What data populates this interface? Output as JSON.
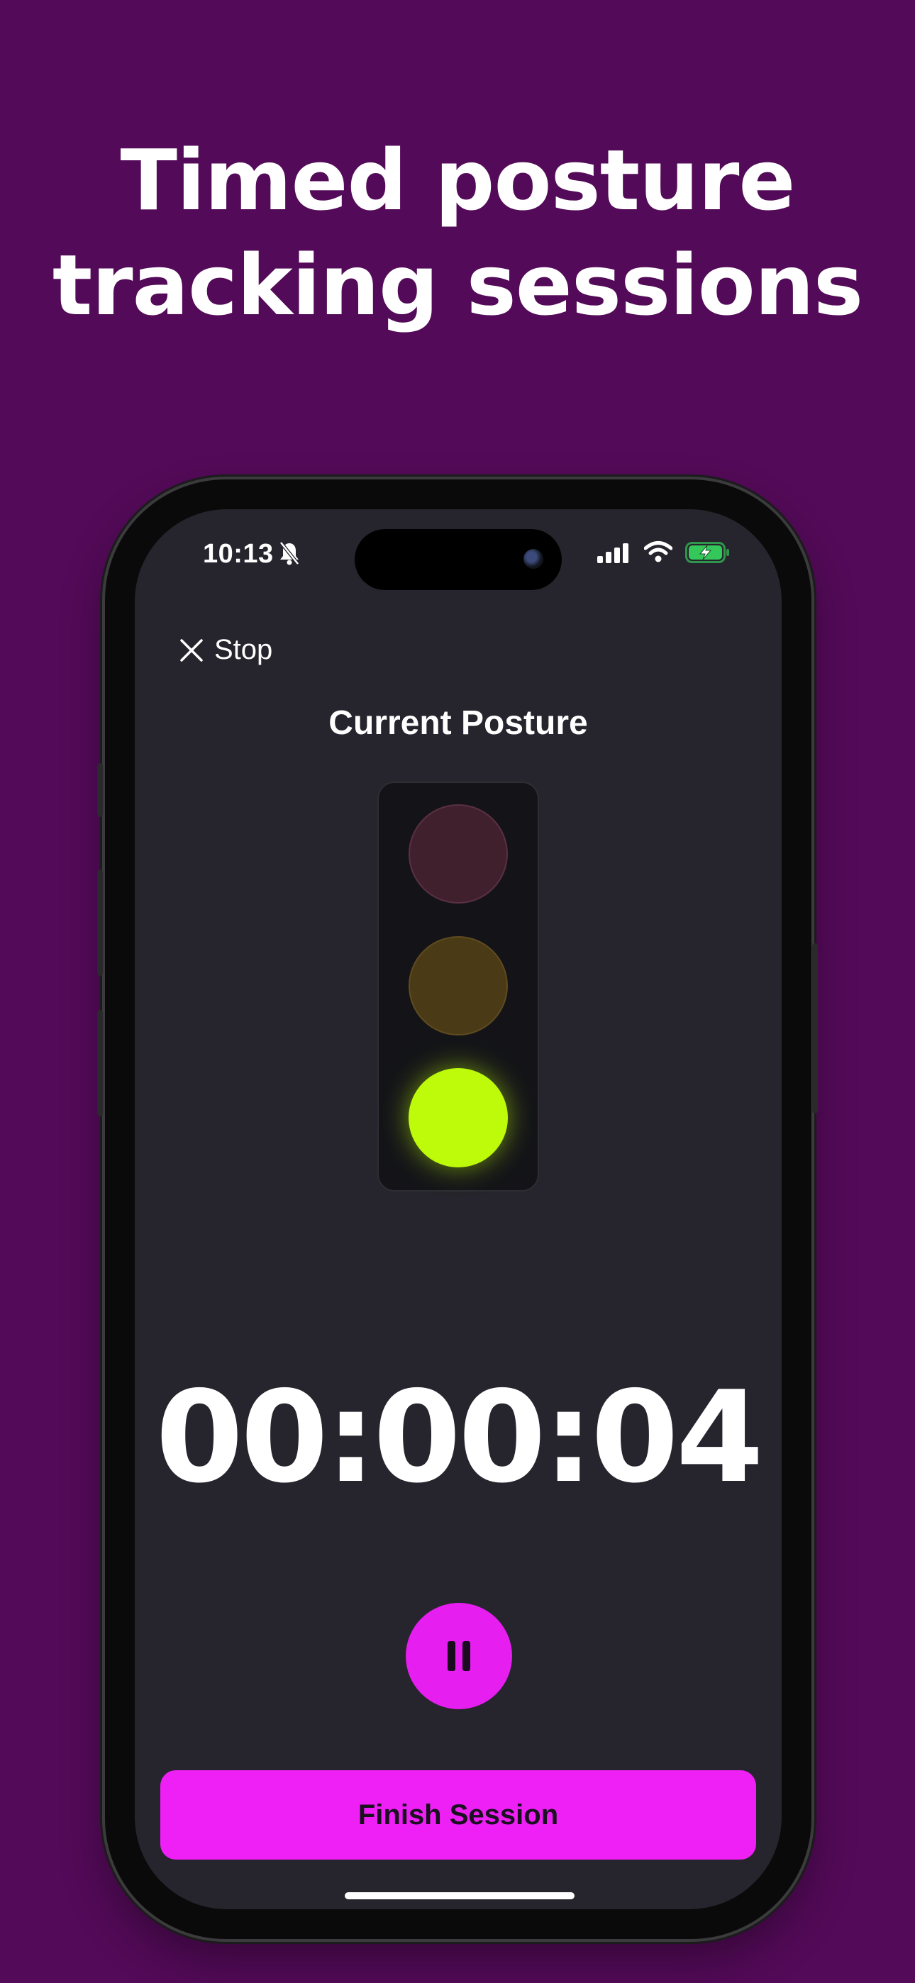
{
  "headline": {
    "line1": "Timed posture",
    "line2": "tracking sessions"
  },
  "status_bar": {
    "time": "10:13",
    "icons": [
      "bell-slash-icon",
      "signal-icon",
      "wifi-icon",
      "battery-charging-icon"
    ]
  },
  "toolbar": {
    "stop_label": "Stop"
  },
  "posture": {
    "title": "Current Posture",
    "active_light": "green",
    "lights": [
      "red",
      "yellow",
      "green"
    ]
  },
  "session": {
    "timer": "00:00:04"
  },
  "actions": {
    "finish_label": "Finish Session"
  },
  "colors": {
    "background": "#530a58",
    "screen": "#26242c",
    "accent": "#ef20f5",
    "active_light": "#bdfb0a"
  }
}
